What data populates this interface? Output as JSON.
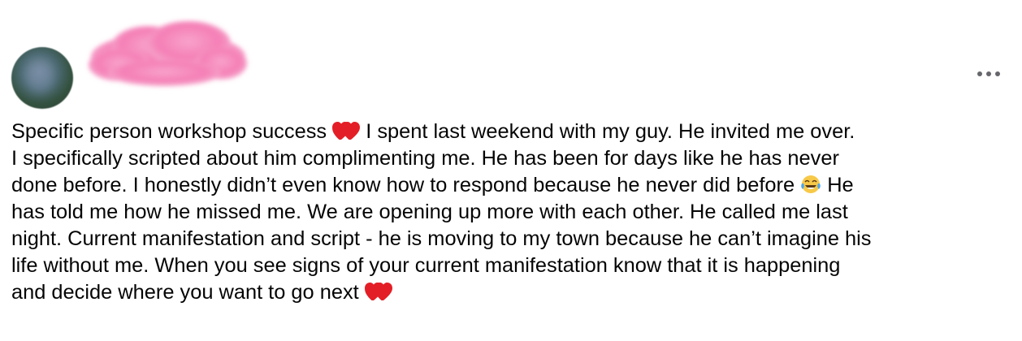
{
  "post": {
    "author_name_redacted": true,
    "more_icon": "more-horizontal-icon",
    "lines": [
      {
        "parts": [
          "Specific person workshop success ",
          "❤❤",
          " I spent last weekend with my guy. He invited me over."
        ]
      },
      {
        "parts": [
          "I specifically scripted about him complimenting me. He has been for days like he has never"
        ]
      },
      {
        "parts": [
          "done before. I honestly didn’t even know how to respond because he never did before ",
          "😂",
          " He"
        ]
      },
      {
        "parts": [
          "has told me how he missed me. We are opening up more with each other. He called me last"
        ]
      },
      {
        "parts": [
          "night. Current manifestation and script - he is moving to my town because he can’t imagine his"
        ]
      },
      {
        "parts": [
          "life without me. When you see signs of your current manifestation know that it is happening"
        ]
      },
      {
        "parts": [
          "and decide where you want to go next ",
          "❤❤"
        ]
      }
    ]
  },
  "colors": {
    "text": "#050505",
    "secondary": "#65676b",
    "heart": "#e41e26",
    "redaction_pink": "#f47fb6"
  }
}
